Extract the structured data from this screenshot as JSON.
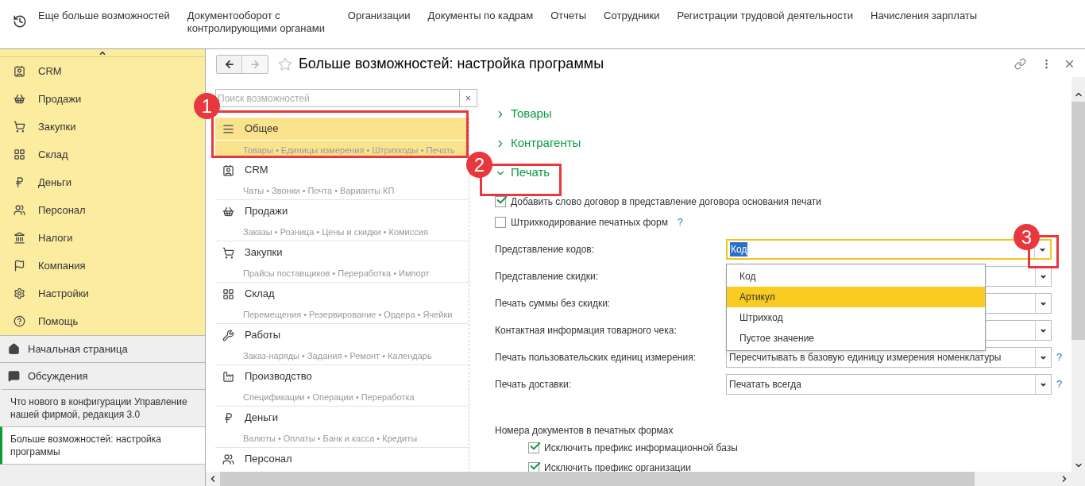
{
  "top_menu": [
    "Еще больше возможностей",
    "Документооборот с контролирующими органами",
    "Организации",
    "Документы по кадрам",
    "Отчеты",
    "Сотрудники",
    "Регистрации трудовой деятельности",
    "Начисления зарплаты"
  ],
  "sidebar": {
    "sections": [
      {
        "label": "CRM"
      },
      {
        "label": "Продажи"
      },
      {
        "label": "Закупки"
      },
      {
        "label": "Склад"
      },
      {
        "label": "Деньги"
      },
      {
        "label": "Персонал"
      },
      {
        "label": "Налоги"
      },
      {
        "label": "Компания"
      },
      {
        "label": "Настройки"
      },
      {
        "label": "Помощь"
      }
    ],
    "links": [
      {
        "label": "Начальная страница"
      },
      {
        "label": "Обсуждения"
      }
    ],
    "open_windows": [
      {
        "label": "Что нового в конфигурации Управление нашей фирмой, редакция 3.0",
        "selected": false
      },
      {
        "label": "Больше возможностей: настройка программы",
        "selected": true
      }
    ]
  },
  "window": {
    "title": "Больше возможностей: настройка программы"
  },
  "search": {
    "placeholder": "Поиск возможностей",
    "clear": "×"
  },
  "features": [
    {
      "name": "Общее",
      "details": "Товары • Единицы измерения • Штрихкоды • Печать",
      "selected": true
    },
    {
      "name": "CRM",
      "details": "Чаты • Звонки • Почта • Варианты КП",
      "selected": false
    },
    {
      "name": "Продажи",
      "details": "Заказы • Розница • Цены и скидки • Комиссия",
      "selected": false
    },
    {
      "name": "Закупки",
      "details": "Прайсы поставщиков • Переработка • Импорт",
      "selected": false
    },
    {
      "name": "Склад",
      "details": "Перемещения • Резервирование • Ордера • Ячейки",
      "selected": false
    },
    {
      "name": "Работы",
      "details": "Заказ-наряды • Задания • Ремонт • Календарь",
      "selected": false
    },
    {
      "name": "Производство",
      "details": "Спецификации • Операции • Переработка",
      "selected": false
    },
    {
      "name": "Деньги",
      "details": "Валюты • Оплаты • Банк и касса • Кредиты",
      "selected": false
    },
    {
      "name": "Персонал",
      "selected": false
    }
  ],
  "groups": [
    {
      "label": "Товары",
      "expanded": false
    },
    {
      "label": "Контрагенты",
      "expanded": false
    },
    {
      "label": "Печать",
      "expanded": true
    }
  ],
  "print_options": [
    {
      "kind": "checkbox",
      "label": "Добавить слово договор в представление договора основания печати",
      "checked": true
    },
    {
      "kind": "checkbox",
      "label": "Штрихкодирование печатных форм",
      "checked": false,
      "help": "?"
    },
    {
      "kind": "select",
      "label": "Представление кодов:",
      "value": "Код",
      "focused": true
    },
    {
      "kind": "select",
      "label": "Представление скидки:",
      "focused": false
    },
    {
      "kind": "select",
      "label": "Печать суммы без скидки:",
      "focused": false
    },
    {
      "kind": "select",
      "label": "Контактная информация товарного чека:",
      "focused": false
    },
    {
      "kind": "select",
      "label": "Печать пользовательских единиц измерения:",
      "value": "Пересчитывать в базовую единицу измерения номенклатуры",
      "focused": false,
      "help": "?"
    },
    {
      "kind": "select",
      "label": "Печать доставки:",
      "value": "Печатать всегда",
      "focused": false,
      "help": "?"
    }
  ],
  "doc_numbers": {
    "title": "Номера документов в печатных формах",
    "options": [
      {
        "label": "Исключить префикс информационной базы",
        "checked": true
      },
      {
        "label": "Исключить префикс организации",
        "checked": true
      }
    ]
  },
  "dropdown": {
    "options": [
      {
        "label": "Код",
        "selected": false
      },
      {
        "label": "Артикул",
        "selected": true
      },
      {
        "label": "Штрихкод",
        "selected": false
      },
      {
        "label": "Пустое значение",
        "selected": false
      }
    ]
  },
  "annotations": [
    {
      "label": "1"
    },
    {
      "label": "2"
    },
    {
      "label": "3"
    }
  ]
}
